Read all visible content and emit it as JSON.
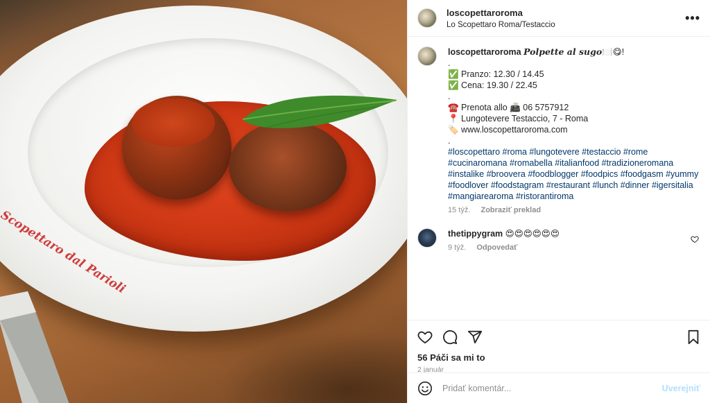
{
  "header": {
    "username": "loscopettaroroma",
    "location": "Lo Scopettaro Roma/Testaccio",
    "more_label": "•••"
  },
  "caption": {
    "username": "loscopettaroroma",
    "dish": "Polpette al sugo",
    "dish_suffix": "🍽️😋!",
    "lines": [
      ".",
      "✅ Pranzo: 12.30 / 14.45",
      "✅ Cena: 19.30 / 22.45",
      ".",
      "☎️ Prenota allo 📠 06 5757912",
      "📍 Lungotevere Testaccio, 7 - Roma",
      "🏷️ www.loscopettaroroma.com",
      "."
    ],
    "hashtags": "#loscopettaro #roma #lungotevere #testaccio #rome #cucinaromana #romabella #italianfood #tradizioneromana #instalike #broovera #foodblogger #foodpics #foodgasm #yummy #foodlover #foodstagram #restaurant #lunch #dinner #igersitalia #mangiarearoma #ristorantiroma",
    "time": "15 týž.",
    "translate": "Zobraziť preklad"
  },
  "comment": {
    "username": "thetippygram",
    "text": "😍😍😍😍😍😍",
    "time": "9 týž.",
    "reply": "Odpovedať"
  },
  "actions": {
    "likes": "56 Páči sa mi to",
    "date": "2 január"
  },
  "add_comment": {
    "placeholder": "Pridať komentár...",
    "post_label": "Uverejniť"
  },
  "photo": {
    "plate_text": "Scopettaro dal Parioli"
  },
  "icons": {
    "like": "heart-icon",
    "comment": "comment-icon",
    "share": "send-icon",
    "save": "bookmark-icon",
    "emoji": "smiley-icon"
  },
  "colors": {
    "hashtag": "#00376b",
    "muted": "#8e8e8e",
    "post_button_disabled": "#b2dffc",
    "text": "#262626"
  }
}
